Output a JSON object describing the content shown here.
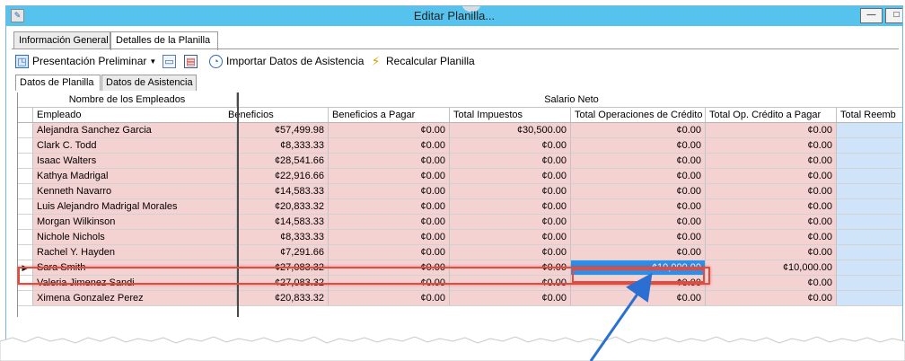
{
  "window": {
    "title": "Editar Planilla...",
    "min_label": "—",
    "max_label": "□"
  },
  "tabs": [
    {
      "label": "Información General"
    },
    {
      "label": "Detalles de la Planilla"
    }
  ],
  "toolbar": {
    "preview_label": "Presentación Preliminar",
    "import_label": "Importar Datos de Asistencia",
    "recalc_label": "Recalcular Planilla"
  },
  "subtabs": [
    {
      "label": "Datos de Planilla"
    },
    {
      "label": "Datos de Asistencia"
    }
  ],
  "grid": {
    "band_employees": "Nombre de los Empleados",
    "band_salary": "Salario Neto",
    "columns": [
      "Empleado",
      "Beneficios",
      "Beneficios a Pagar",
      "Total Impuestos",
      "Total Operaciones de Crédito",
      "Total Op. Crédito a Pagar",
      "Total Reemb"
    ],
    "rows": [
      {
        "name": "Alejandra Sanchez Garcia",
        "c1": "¢57,499.98",
        "c2": "¢0.00",
        "c3": "¢30,500.00",
        "c4": "¢0.00",
        "c5": "¢0.00"
      },
      {
        "name": "Clark C. Todd",
        "c1": "¢8,333.33",
        "c2": "¢0.00",
        "c3": "¢0.00",
        "c4": "¢0.00",
        "c5": "¢0.00"
      },
      {
        "name": "Isaac Walters",
        "c1": "¢28,541.66",
        "c2": "¢0.00",
        "c3": "¢0.00",
        "c4": "¢0.00",
        "c5": "¢0.00"
      },
      {
        "name": "Kathya Madrigal",
        "c1": "¢22,916.66",
        "c2": "¢0.00",
        "c3": "¢0.00",
        "c4": "¢0.00",
        "c5": "¢0.00"
      },
      {
        "name": "Kenneth Navarro",
        "c1": "¢14,583.33",
        "c2": "¢0.00",
        "c3": "¢0.00",
        "c4": "¢0.00",
        "c5": "¢0.00"
      },
      {
        "name": "Luis Alejandro Madrigal Morales",
        "c1": "¢20,833.32",
        "c2": "¢0.00",
        "c3": "¢0.00",
        "c4": "¢0.00",
        "c5": "¢0.00"
      },
      {
        "name": "Morgan Wilkinson",
        "c1": "¢14,583.33",
        "c2": "¢0.00",
        "c3": "¢0.00",
        "c4": "¢0.00",
        "c5": "¢0.00"
      },
      {
        "name": "Nichole Nichols",
        "c1": "¢8,333.33",
        "c2": "¢0.00",
        "c3": "¢0.00",
        "c4": "¢0.00",
        "c5": "¢0.00"
      },
      {
        "name": "Rachel Y. Hayden",
        "c1": "¢7,291.66",
        "c2": "¢0.00",
        "c3": "¢0.00",
        "c4": "¢0.00",
        "c5": "¢0.00"
      },
      {
        "name": "Sara Smith",
        "c1": "¢27,083.32",
        "c2": "¢0.00",
        "c3": "¢0.00",
        "c4": "¢10,000.00",
        "c5": "¢10,000.00"
      },
      {
        "name": "Valeria Jimenez Sandi",
        "c1": "¢27,083.32",
        "c2": "¢0.00",
        "c3": "¢0.00",
        "c4": "¢0.00",
        "c5": "¢0.00"
      },
      {
        "name": "Ximena Gonzalez Perez",
        "c1": "¢20,833.32",
        "c2": "¢0.00",
        "c3": "¢0.00",
        "c4": "¢0.00",
        "c5": "¢0.00"
      }
    ],
    "selected_row_indicator": "▶"
  },
  "colors": {
    "titlebar": "#56c3ef",
    "row_pink": "#f4d2d2",
    "selected_cell": "#2f8ee8",
    "highlight_border": "#e24c3f",
    "arrow": "#2a6fd1"
  },
  "icons": {
    "preview": "preview-icon",
    "chat": "chat-icon",
    "doc": "document-icon",
    "import": "clock-icon",
    "recalc": "lightning-icon"
  }
}
